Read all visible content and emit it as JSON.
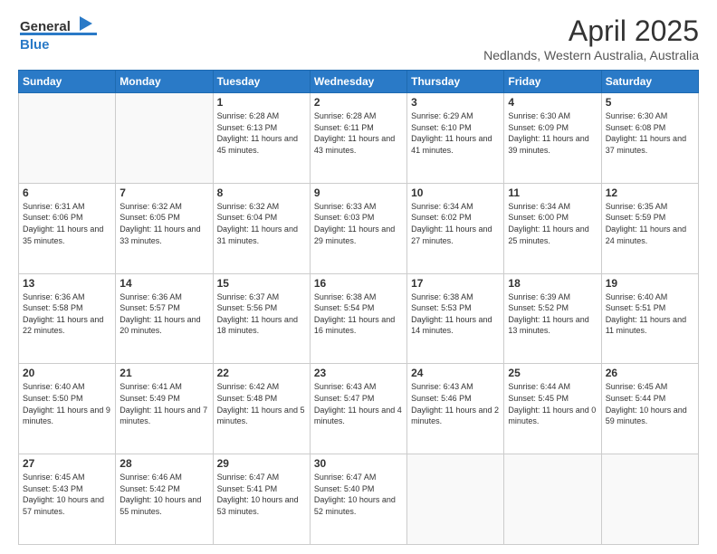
{
  "header": {
    "logo_line1": "General",
    "logo_line2": "Blue",
    "title": "April 2025",
    "location": "Nedlands, Western Australia, Australia"
  },
  "days_of_week": [
    "Sunday",
    "Monday",
    "Tuesday",
    "Wednesday",
    "Thursday",
    "Friday",
    "Saturday"
  ],
  "weeks": [
    [
      {
        "day": "",
        "info": ""
      },
      {
        "day": "",
        "info": ""
      },
      {
        "day": "1",
        "info": "Sunrise: 6:28 AM\nSunset: 6:13 PM\nDaylight: 11 hours and 45 minutes."
      },
      {
        "day": "2",
        "info": "Sunrise: 6:28 AM\nSunset: 6:11 PM\nDaylight: 11 hours and 43 minutes."
      },
      {
        "day": "3",
        "info": "Sunrise: 6:29 AM\nSunset: 6:10 PM\nDaylight: 11 hours and 41 minutes."
      },
      {
        "day": "4",
        "info": "Sunrise: 6:30 AM\nSunset: 6:09 PM\nDaylight: 11 hours and 39 minutes."
      },
      {
        "day": "5",
        "info": "Sunrise: 6:30 AM\nSunset: 6:08 PM\nDaylight: 11 hours and 37 minutes."
      }
    ],
    [
      {
        "day": "6",
        "info": "Sunrise: 6:31 AM\nSunset: 6:06 PM\nDaylight: 11 hours and 35 minutes."
      },
      {
        "day": "7",
        "info": "Sunrise: 6:32 AM\nSunset: 6:05 PM\nDaylight: 11 hours and 33 minutes."
      },
      {
        "day": "8",
        "info": "Sunrise: 6:32 AM\nSunset: 6:04 PM\nDaylight: 11 hours and 31 minutes."
      },
      {
        "day": "9",
        "info": "Sunrise: 6:33 AM\nSunset: 6:03 PM\nDaylight: 11 hours and 29 minutes."
      },
      {
        "day": "10",
        "info": "Sunrise: 6:34 AM\nSunset: 6:02 PM\nDaylight: 11 hours and 27 minutes."
      },
      {
        "day": "11",
        "info": "Sunrise: 6:34 AM\nSunset: 6:00 PM\nDaylight: 11 hours and 25 minutes."
      },
      {
        "day": "12",
        "info": "Sunrise: 6:35 AM\nSunset: 5:59 PM\nDaylight: 11 hours and 24 minutes."
      }
    ],
    [
      {
        "day": "13",
        "info": "Sunrise: 6:36 AM\nSunset: 5:58 PM\nDaylight: 11 hours and 22 minutes."
      },
      {
        "day": "14",
        "info": "Sunrise: 6:36 AM\nSunset: 5:57 PM\nDaylight: 11 hours and 20 minutes."
      },
      {
        "day": "15",
        "info": "Sunrise: 6:37 AM\nSunset: 5:56 PM\nDaylight: 11 hours and 18 minutes."
      },
      {
        "day": "16",
        "info": "Sunrise: 6:38 AM\nSunset: 5:54 PM\nDaylight: 11 hours and 16 minutes."
      },
      {
        "day": "17",
        "info": "Sunrise: 6:38 AM\nSunset: 5:53 PM\nDaylight: 11 hours and 14 minutes."
      },
      {
        "day": "18",
        "info": "Sunrise: 6:39 AM\nSunset: 5:52 PM\nDaylight: 11 hours and 13 minutes."
      },
      {
        "day": "19",
        "info": "Sunrise: 6:40 AM\nSunset: 5:51 PM\nDaylight: 11 hours and 11 minutes."
      }
    ],
    [
      {
        "day": "20",
        "info": "Sunrise: 6:40 AM\nSunset: 5:50 PM\nDaylight: 11 hours and 9 minutes."
      },
      {
        "day": "21",
        "info": "Sunrise: 6:41 AM\nSunset: 5:49 PM\nDaylight: 11 hours and 7 minutes."
      },
      {
        "day": "22",
        "info": "Sunrise: 6:42 AM\nSunset: 5:48 PM\nDaylight: 11 hours and 5 minutes."
      },
      {
        "day": "23",
        "info": "Sunrise: 6:43 AM\nSunset: 5:47 PM\nDaylight: 11 hours and 4 minutes."
      },
      {
        "day": "24",
        "info": "Sunrise: 6:43 AM\nSunset: 5:46 PM\nDaylight: 11 hours and 2 minutes."
      },
      {
        "day": "25",
        "info": "Sunrise: 6:44 AM\nSunset: 5:45 PM\nDaylight: 11 hours and 0 minutes."
      },
      {
        "day": "26",
        "info": "Sunrise: 6:45 AM\nSunset: 5:44 PM\nDaylight: 10 hours and 59 minutes."
      }
    ],
    [
      {
        "day": "27",
        "info": "Sunrise: 6:45 AM\nSunset: 5:43 PM\nDaylight: 10 hours and 57 minutes."
      },
      {
        "day": "28",
        "info": "Sunrise: 6:46 AM\nSunset: 5:42 PM\nDaylight: 10 hours and 55 minutes."
      },
      {
        "day": "29",
        "info": "Sunrise: 6:47 AM\nSunset: 5:41 PM\nDaylight: 10 hours and 53 minutes."
      },
      {
        "day": "30",
        "info": "Sunrise: 6:47 AM\nSunset: 5:40 PM\nDaylight: 10 hours and 52 minutes."
      },
      {
        "day": "",
        "info": ""
      },
      {
        "day": "",
        "info": ""
      },
      {
        "day": "",
        "info": ""
      }
    ]
  ]
}
